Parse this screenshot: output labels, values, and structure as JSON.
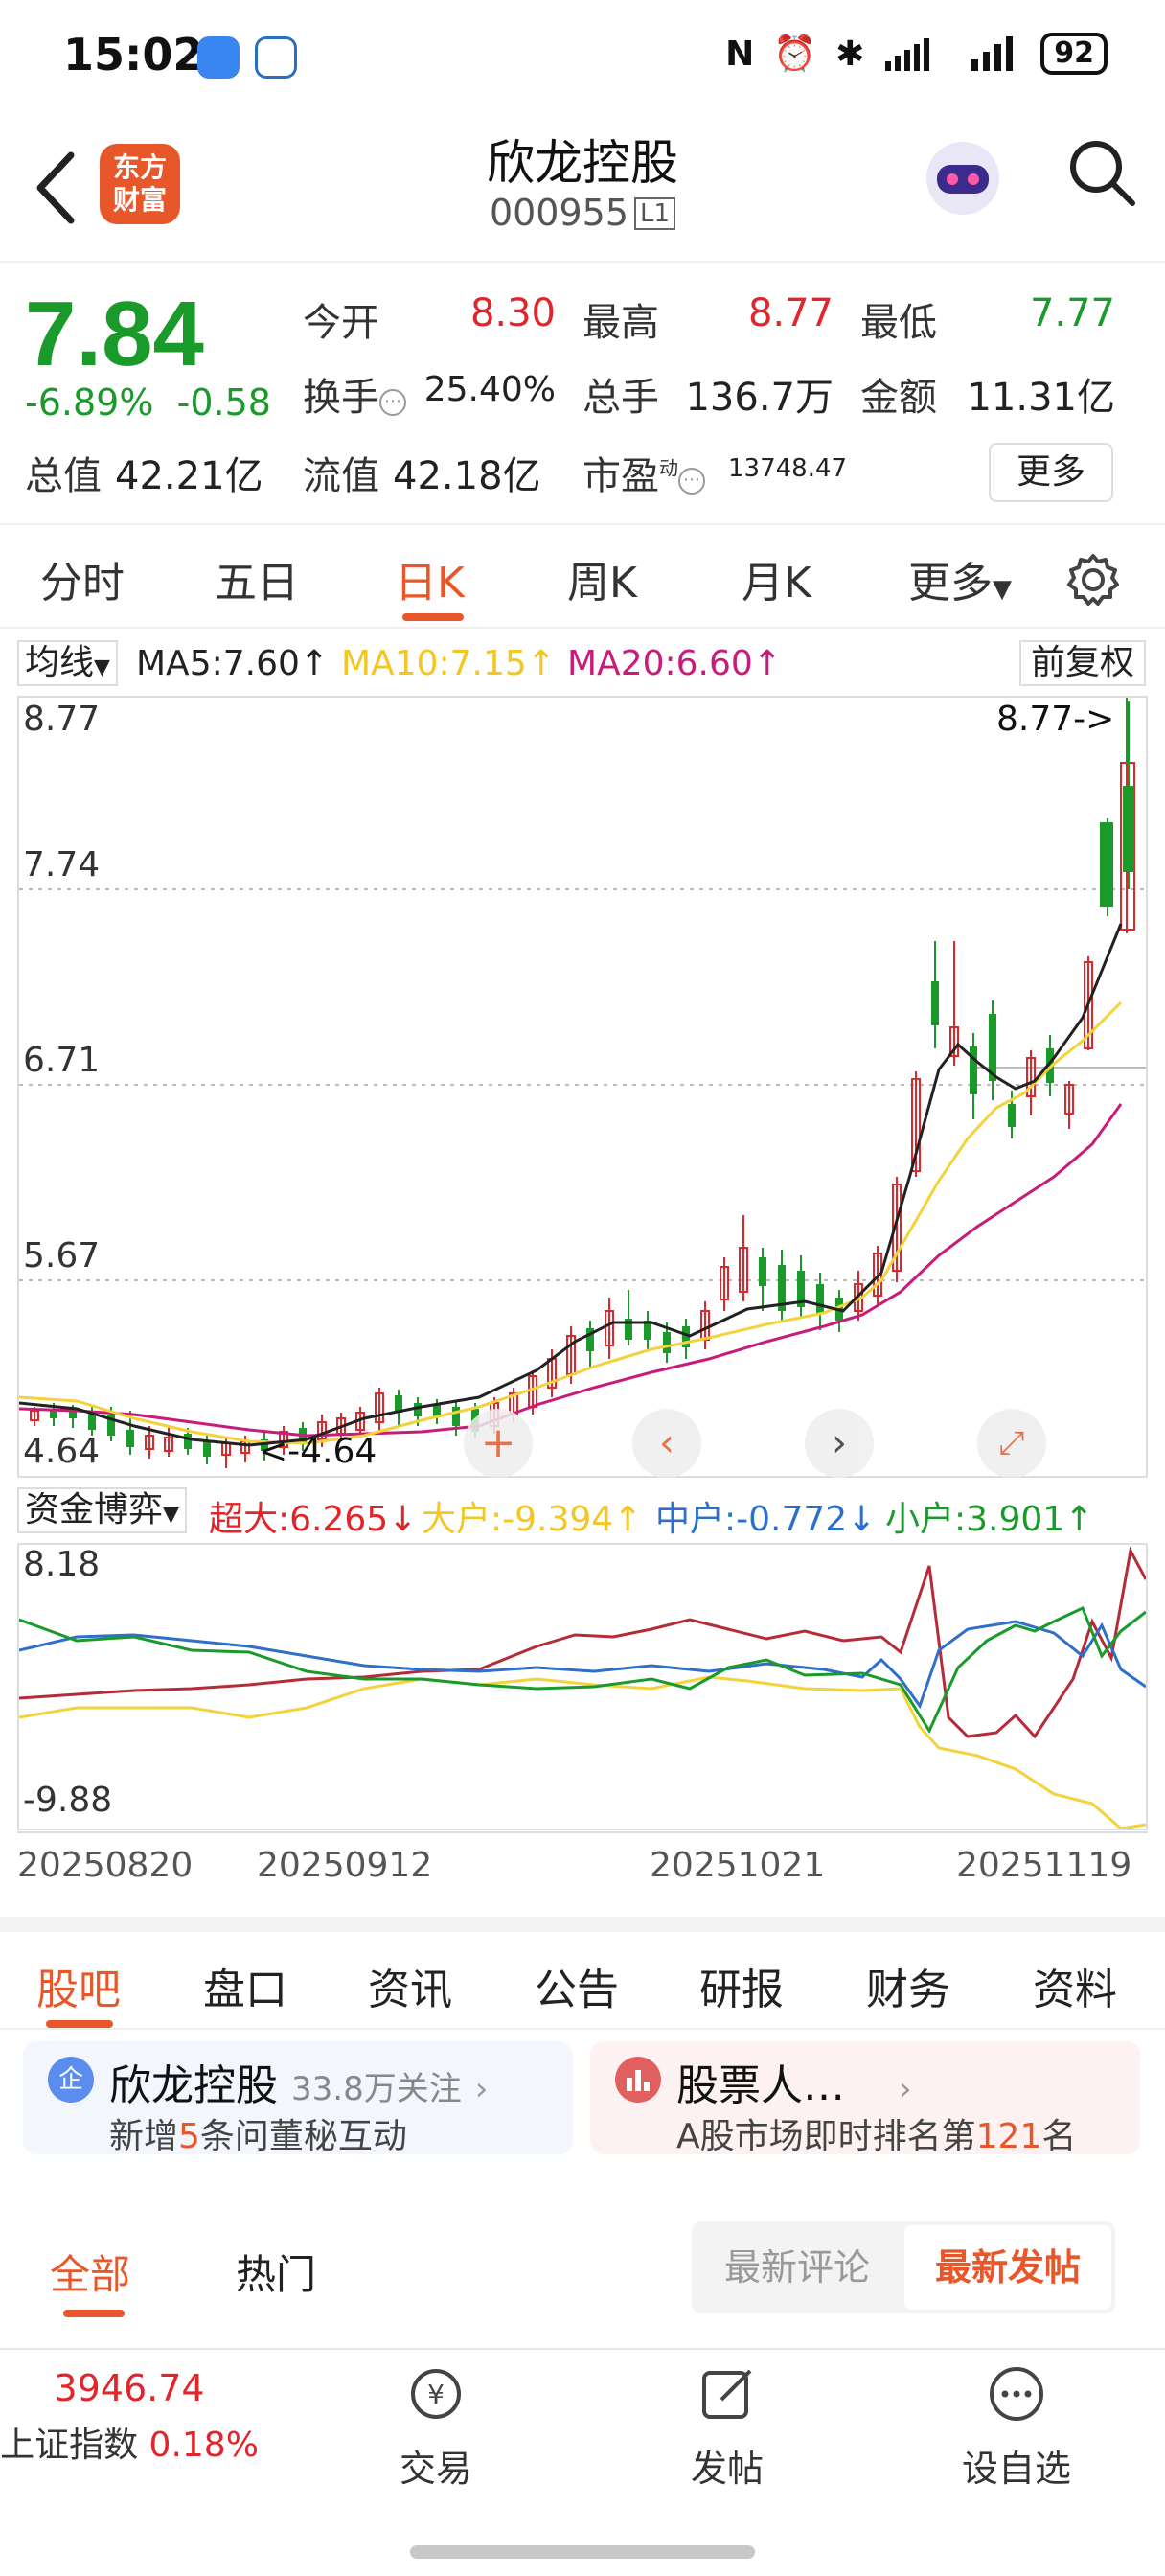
{
  "status_bar": {
    "time": "15:02",
    "battery": "92"
  },
  "header": {
    "logo_text": "东方\n财富",
    "stock_name": "欣龙控股",
    "stock_code": "000955",
    "level_badge": "L1"
  },
  "quote": {
    "price": "7.84",
    "change_pct": "-6.89%",
    "change_abs": "-0.58",
    "open_label": "今开",
    "open_value": "8.30",
    "high_label": "最高",
    "high_value": "8.77",
    "low_label": "最低",
    "low_value": "7.77",
    "turnover_label": "换手",
    "turnover_value": "25.40%",
    "volume_label": "总手",
    "volume_value": "136.7万",
    "amount_label": "金额",
    "amount_value": "11.31亿",
    "mktcap_label": "总值",
    "mktcap_value": "42.21亿",
    "float_label": "流值",
    "float_value": "42.18亿",
    "pe_label": "市盈",
    "pe_sup": "动",
    "pe_value": "13748.47",
    "more_button": "更多"
  },
  "period_tabs": [
    "分时",
    "五日",
    "日K",
    "周K",
    "月K",
    "更多"
  ],
  "ma_row": {
    "select_label": "均线",
    "ma5": "MA5:7.60↑",
    "ma10": "MA10:7.15↑",
    "ma20": "MA20:6.60↑",
    "adjust": "前复权"
  },
  "kchart_axis": {
    "y1": "8.77",
    "y2": "7.74",
    "y3": "6.71",
    "y4": "5.67",
    "y5": "4.64",
    "max_note": "8.77->",
    "min_note": "<-4.64"
  },
  "flow_row": {
    "select_label": "资金博弈",
    "super": "超大:6.265↓",
    "large": "大户:-9.394↑",
    "medium": "中户:-0.772↓",
    "small": "小户:3.901↑"
  },
  "flow_axis": {
    "top": "8.18",
    "bottom": "-9.88"
  },
  "dates": [
    "20250820",
    "20250912",
    "20251021",
    "20251119"
  ],
  "section_tabs": [
    "股吧",
    "盘口",
    "资讯",
    "公告",
    "研报",
    "财务",
    "资料"
  ],
  "card_left": {
    "title": "欣龙控股",
    "followers": "33.8万关注",
    "subtitle_pre": "新增",
    "subtitle_num": "5",
    "subtitle_post": "条问董秘互动"
  },
  "card_right": {
    "title": "股票人…",
    "subtitle_pre": "A股市场即时排名第",
    "subtitle_num": "121",
    "subtitle_post": "名"
  },
  "feed_tabs": {
    "all": "全部",
    "hot": "热门",
    "latest_comment": "最新评论",
    "latest_post": "最新发帖"
  },
  "bottom_bar": {
    "index_value": "3946.74",
    "index_name": "上证指数",
    "index_change": "0.18%",
    "trade": "交易",
    "post": "发帖",
    "watch": "设自选"
  },
  "colors": {
    "up": "#e0262b",
    "down": "#1a9a2a",
    "accent": "#e8572a",
    "ma10": "#f3d23b",
    "ma20": "#c81c7a",
    "medium": "#2d6fc9"
  }
}
